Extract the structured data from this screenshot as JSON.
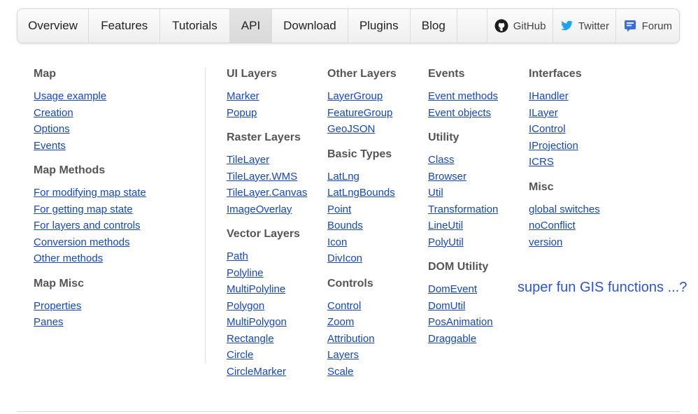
{
  "nav": {
    "items": [
      "Overview",
      "Features",
      "Tutorials",
      "API",
      "Download",
      "Plugins",
      "Blog"
    ],
    "active": "API",
    "external": [
      {
        "label": "GitHub",
        "icon": "github-icon"
      },
      {
        "label": "Twitter",
        "icon": "twitter-icon"
      },
      {
        "label": "Forum",
        "icon": "forum-icon"
      }
    ]
  },
  "columns": [
    {
      "groups": [
        {
          "title": "Map",
          "links": [
            "Usage example",
            "Creation",
            "Options",
            "Events"
          ]
        },
        {
          "title": "Map Methods",
          "links": [
            "For modifying map state",
            "For getting map state",
            "For layers and controls",
            "Conversion methods",
            "Other methods"
          ]
        },
        {
          "title": "Map Misc",
          "links": [
            "Properties",
            "Panes"
          ]
        }
      ]
    },
    {
      "groups": [
        {
          "title": "UI Layers",
          "links": [
            "Marker",
            "Popup"
          ]
        },
        {
          "title": "Raster Layers",
          "links": [
            "TileLayer",
            "TileLayer.WMS",
            "TileLayer.Canvas",
            "ImageOverlay"
          ]
        },
        {
          "title": "Vector Layers",
          "links": [
            "Path",
            "Polyline",
            "MultiPolyline",
            "Polygon",
            "MultiPolygon",
            "Rectangle",
            "Circle",
            "CircleMarker"
          ]
        }
      ]
    },
    {
      "groups": [
        {
          "title": "Other Layers",
          "links": [
            "LayerGroup",
            "FeatureGroup",
            "GeoJSON"
          ]
        },
        {
          "title": "Basic Types",
          "links": [
            "LatLng",
            "LatLngBounds",
            "Point",
            "Bounds",
            "Icon",
            "DivIcon"
          ]
        },
        {
          "title": "Controls",
          "links": [
            "Control",
            "Zoom",
            "Attribution",
            "Layers",
            "Scale"
          ]
        }
      ]
    },
    {
      "groups": [
        {
          "title": "Events",
          "links": [
            "Event methods",
            "Event objects"
          ]
        },
        {
          "title": "Utility",
          "links": [
            "Class",
            "Browser",
            "Util",
            "Transformation",
            "LineUtil",
            "PolyUtil"
          ]
        },
        {
          "title": "DOM Utility",
          "links": [
            "DomEvent",
            "DomUtil",
            "PosAnimation",
            "Draggable"
          ]
        }
      ]
    },
    {
      "groups": [
        {
          "title": "Interfaces",
          "links": [
            "IHandler",
            "ILayer",
            "IControl",
            "IProjection",
            "ICRS"
          ]
        },
        {
          "title": "Misc",
          "links": [
            "global switches",
            "noConflict",
            "version"
          ]
        }
      ]
    }
  ],
  "annotation": "super fun GIS functions ...?",
  "colors": {
    "link": "#1446c8",
    "heading": "#555555",
    "annotation": "#2a55d6",
    "twitter": "#1da1f2",
    "forum": "#3b6fd8"
  }
}
